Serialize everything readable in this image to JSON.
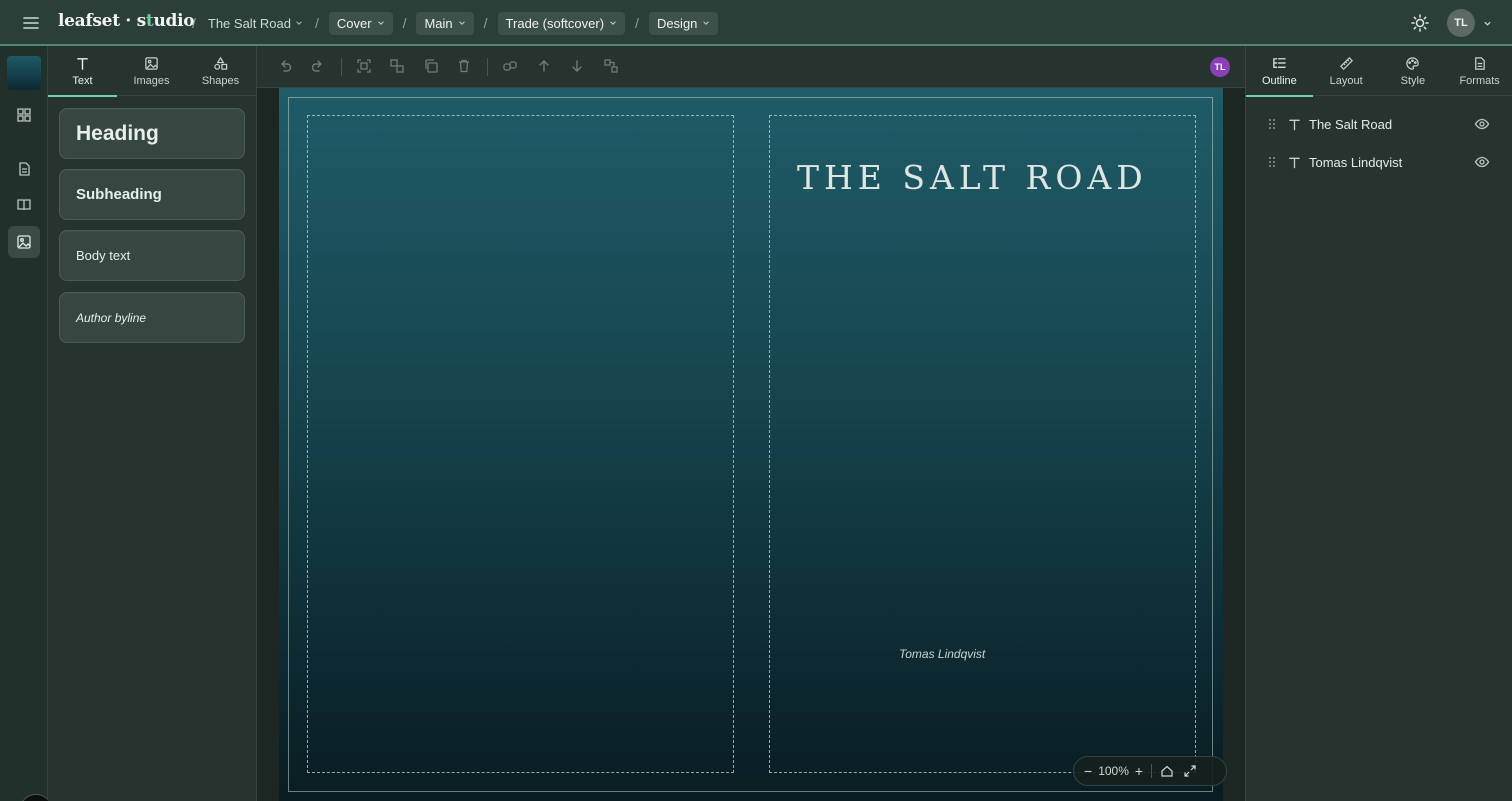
{
  "app": {
    "brand_main": "leafset",
    "brand_dot": "·",
    "brand_s": "s",
    "brand_accent": "t",
    "brand_tail": "udio"
  },
  "breadcrumbs": {
    "separator": "/",
    "project": "The Salt Road",
    "section": "Cover",
    "variant": "Main",
    "format": "Trade (softcover)",
    "mode": "Design"
  },
  "user": {
    "initials": "TL"
  },
  "left_panel": {
    "tabs": [
      {
        "label": "Text",
        "icon": "text-icon"
      },
      {
        "label": "Images",
        "icon": "image-icon"
      },
      {
        "label": "Shapes",
        "icon": "shapes-icon"
      }
    ],
    "active_tab": "Text",
    "presets": {
      "heading": "Heading",
      "subheading": "Subheading",
      "body": "Body text",
      "byline": "Author byline"
    }
  },
  "toolbar": {
    "collaborator_initials": "TL",
    "collaborator_color": "#8a3fb5"
  },
  "cover": {
    "title": "THE SALT ROAD",
    "author": "Tomas Lindqvist",
    "gradient_top": "#1f5c68",
    "gradient_bottom": "#091c22"
  },
  "zoom": {
    "value": "100%",
    "minus": "−",
    "plus": "+"
  },
  "right_panel": {
    "tabs": [
      {
        "label": "Outline",
        "icon": "outline-icon"
      },
      {
        "label": "Layout",
        "icon": "ruler-icon"
      },
      {
        "label": "Style",
        "icon": "palette-icon"
      },
      {
        "label": "Formats",
        "icon": "document-icon"
      }
    ],
    "active_tab": "Outline",
    "layers": [
      {
        "name": "The Salt Road"
      },
      {
        "name": "Tomas Lindqvist"
      }
    ]
  },
  "colors": {
    "accent": "#6fd0a0",
    "topbar": "#2b3f38",
    "panel": "#27332f"
  }
}
